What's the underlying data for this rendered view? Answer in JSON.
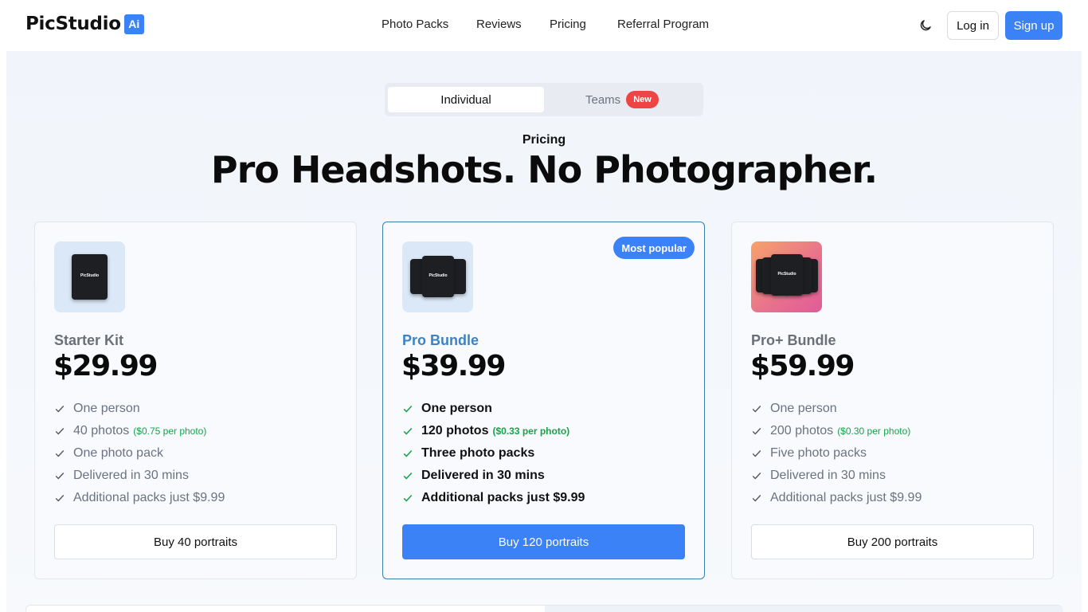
{
  "brand": {
    "name": "PicStudio",
    "badge": "Ai",
    "accent": "#3b82f6"
  },
  "nav": {
    "items": [
      "Photo Packs",
      "Reviews",
      "Pricing",
      "Referral Program"
    ]
  },
  "header": {
    "login": "Log in",
    "signup": "Sign up",
    "theme_icon": "moon-icon"
  },
  "toggle": {
    "individual": "Individual",
    "teams": "Teams",
    "new_badge": "New",
    "selected": "Individual"
  },
  "pricing": {
    "eyebrow": "Pricing",
    "headline": "Pro Headshots. No Photographer."
  },
  "plans": [
    {
      "name": "Starter Kit",
      "price": "$29.99",
      "features": [
        "One person",
        "40 photos",
        "One photo pack",
        "Delivered in 30 mins",
        "Additional packs just $9.99"
      ],
      "per_photo": "($0.75 per photo)",
      "cta": "Buy 40 portraits"
    },
    {
      "name": "Pro Bundle",
      "price": "$39.99",
      "badge": "Most popular",
      "features": [
        "One person",
        "120 photos",
        "Three photo packs",
        "Delivered in 30 mins",
        "Additional packs just $9.99"
      ],
      "per_photo": "($0.33 per photo)",
      "cta": "Buy 120 portraits"
    },
    {
      "name": "Pro+ Bundle",
      "price": "$59.99",
      "features": [
        "One person",
        "200 photos",
        "Five photo packs",
        "Delivered in 30 mins",
        "Additional packs just $9.99"
      ],
      "per_photo": "($0.30 per photo)",
      "cta": "Buy 200 portraits"
    }
  ],
  "pack_label": "PicStudio"
}
